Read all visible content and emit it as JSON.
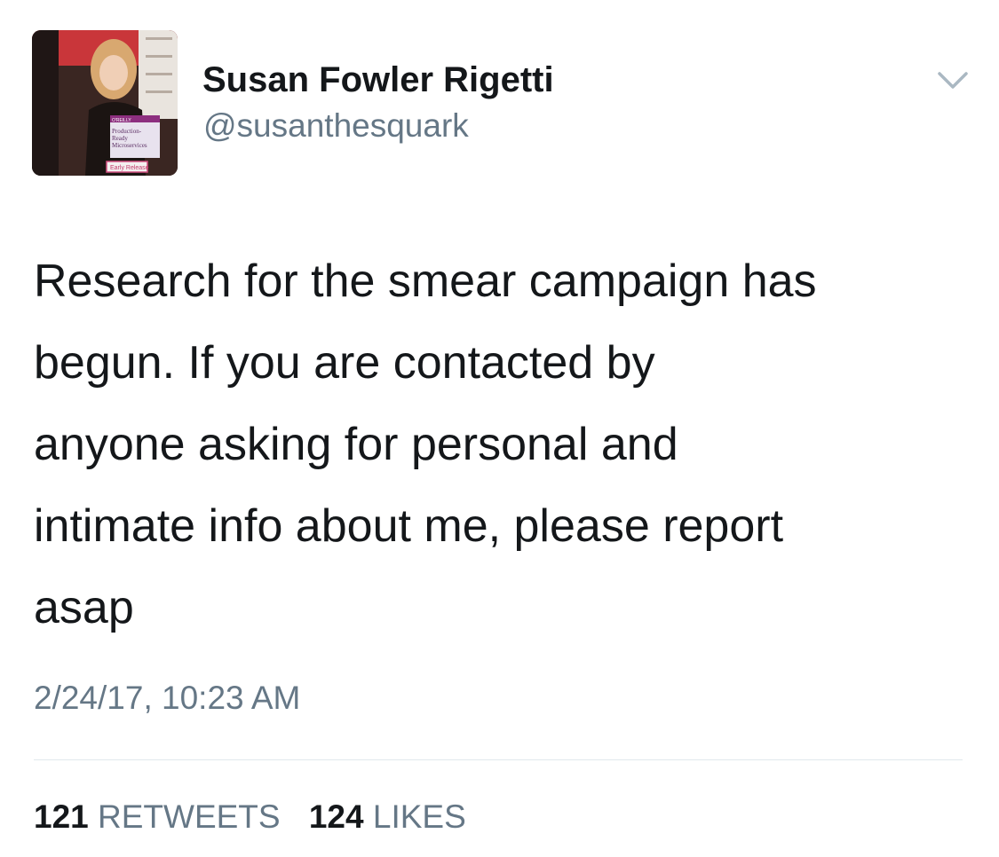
{
  "author": {
    "display_name": "Susan Fowler Rigetti",
    "handle": "@susanthesquark",
    "avatar_book": {
      "brand": "O'REILLY",
      "title_line1": "Production-",
      "title_line2": "Ready",
      "title_line3": "Microservices",
      "badge": "Early Release"
    }
  },
  "tweet": {
    "text": "Research for the smear campaign has\nbegun. If you are contacted by\nanyone asking for personal and\nintimate info about me, please report\nasap",
    "timestamp": "2/24/17, 10:23 AM"
  },
  "stats": {
    "retweets_count": "121",
    "retweets_label": "RETWEETS",
    "likes_count": "124",
    "likes_label": "LIKES"
  },
  "icons": {
    "menu": "chevron-down-icon"
  },
  "colors": {
    "text_primary": "#14171a",
    "text_secondary": "#657786",
    "divider": "#e1e8ed"
  }
}
